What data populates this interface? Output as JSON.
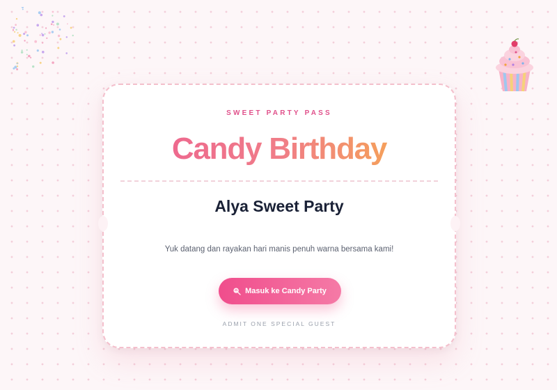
{
  "ticket": {
    "eyebrow": "SWEET PARTY PASS",
    "title": "Candy Birthday",
    "event_name": "Alya Sweet Party",
    "description": "Yuk datang dan rayakan hari manis penuh warna bersama kami!",
    "cta_label": "Masuk ke Candy Party",
    "cta_icon": "lollipop-icon",
    "footer": "ADMIT ONE SPECIAL GUEST"
  },
  "decorations": {
    "corner_art": "confetti-sprinkles",
    "cupcake": "cupcake-icon"
  },
  "colors": {
    "accent_pink": "#e0518b",
    "title_gradient_start": "#ec5d92",
    "title_gradient_end": "#f8b440",
    "button_start": "#f04d8c",
    "button_end": "#f57aa6",
    "text_dark": "#1a2136",
    "text_muted": "#5b6170"
  }
}
